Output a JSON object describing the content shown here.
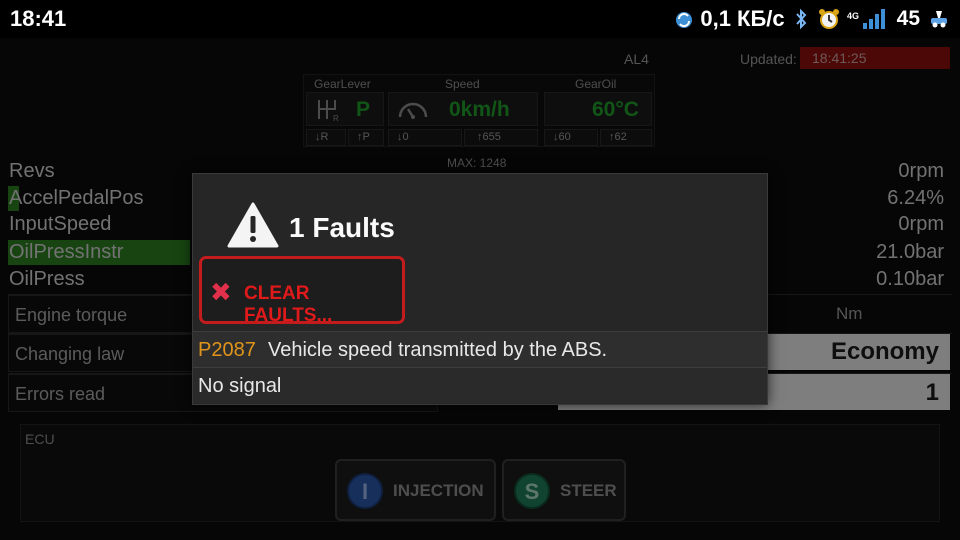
{
  "status_bar": {
    "time": "18:41",
    "network_speed": "0,1 КБ/с",
    "network_type": "4G",
    "battery": "45"
  },
  "header": {
    "mode": "AL4",
    "updated_label": "Updated:",
    "updated_time": "18:41:25"
  },
  "gauges": {
    "gear_lever": {
      "title": "GearLever",
      "value": "P",
      "sub_left": "↓R",
      "sub_right": "↑P"
    },
    "speed": {
      "title": "Speed",
      "value": "0km/h",
      "sub_left": "↓0",
      "sub_right": "↑655"
    },
    "gear_oil": {
      "title": "GearOil",
      "value": "60°C",
      "sub_left": "↓60",
      "sub_right": "↑62"
    }
  },
  "max_label": "MAX: 1248",
  "rows": [
    {
      "label": "Revs",
      "value": "0rpm",
      "bar": 0
    },
    {
      "label": "AccelPedalPos",
      "value": "6.24%",
      "bar": 0.0624
    },
    {
      "label": "InputSpeed",
      "value": "0rpm",
      "bar": 0
    },
    {
      "label": "OilPressInstr",
      "value": "21.0bar",
      "bar": 1
    },
    {
      "label": "OilPress",
      "value": "0.10bar",
      "bar": 0
    }
  ],
  "table": {
    "engine_torque_label": "Engine torque",
    "engine_torque_unit": "Nm",
    "changing_law_label": "Changing law",
    "changing_law_value": "Economy",
    "errors_read_label": "Errors read",
    "errors_read_value": "1"
  },
  "ecu": {
    "label": "ECU",
    "buttons": [
      {
        "letter": "I",
        "label": "INJECTION"
      },
      {
        "letter": "S",
        "label": "STEER"
      }
    ]
  },
  "dialog": {
    "title": "1 Faults",
    "clear_button_label": "CLEAR FAULTS...",
    "faults": [
      {
        "code": "P2087",
        "description": "Vehicle speed transmitted by the ABS."
      }
    ],
    "signal_text": "No signal"
  },
  "colors": {
    "accent_green": "#1f9c2a",
    "bar_green": "#2b7d20",
    "updated_bg": "#8a0d0d",
    "clear_red": "#e01a1a",
    "fault_code": "#e0951a"
  }
}
